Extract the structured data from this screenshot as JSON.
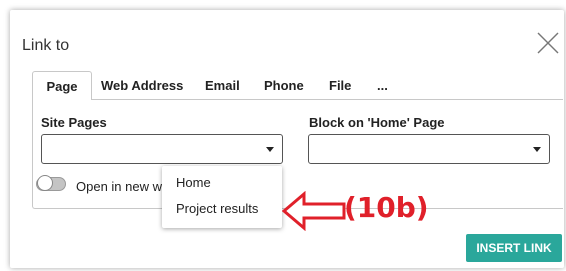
{
  "dialog": {
    "title": "Link to",
    "close_icon": "close-icon"
  },
  "tabs": [
    {
      "label": "Page",
      "active": true
    },
    {
      "label": "Web Address"
    },
    {
      "label": "Email"
    },
    {
      "label": "Phone"
    },
    {
      "label": "File"
    },
    {
      "label": "..."
    }
  ],
  "site_pages": {
    "label": "Site Pages",
    "value": "",
    "options": [
      "Home",
      "Project results"
    ]
  },
  "block": {
    "label": "Block on 'Home' Page",
    "value": ""
  },
  "toggle": {
    "label": "Open in new window",
    "on": false
  },
  "annotation": {
    "label": "(10b)",
    "color": "#e0202a"
  },
  "actions": {
    "insert_label": "INSERT LINK",
    "insert_color": "#2aa79b"
  }
}
